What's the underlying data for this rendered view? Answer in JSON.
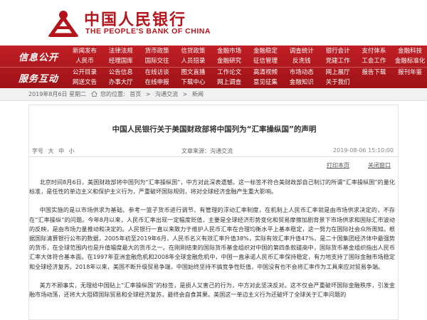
{
  "header": {
    "logo_cn": "中国人民银行",
    "logo_en": "THE PEOPLE'S BANK OF CHINA"
  },
  "nav": {
    "section1": "信息公开",
    "section2": "服务互动",
    "row1_top": [
      "新闻发布",
      "法律法规",
      "货币政策",
      "信贷政策",
      "金融市场",
      "金融稳定",
      "调查统计",
      "银行会计",
      "支付体系",
      "金融科技"
    ],
    "row1_bot": [
      "人民币",
      "经理国库",
      "国际交往",
      "人员招录",
      "金融研究",
      "征信管理",
      "反洗钱",
      "党建工作",
      "工会工作",
      "金融标准化"
    ],
    "row2_top": [
      "公开目录",
      "公告信息",
      "在线访谈",
      "图文直播",
      "工作论文",
      "高清视频",
      "市场动态",
      "网上展厅",
      "报告下载",
      "报刊年鉴"
    ],
    "row2_bot": [
      "网送文告",
      "办事大厅",
      "在线申报",
      "下载中心",
      "网上调查",
      "意见征集",
      "金融知识",
      "关于我们",
      "",
      ""
    ]
  },
  "breadcrumb": {
    "date": "2019年8月6日 星期二",
    "items": [
      "您的位置:",
      "首页",
      ">",
      "沟通交流",
      ">",
      "新闻"
    ]
  },
  "article": {
    "title": "中国人民银行关于美国财政部将中国列为“汇率操纵国”的声明",
    "font_size_label": "字号",
    "font_sizes": [
      "大",
      "中",
      "小"
    ],
    "source": "文章来源：沟通交流",
    "time": "2019-08-06 15:10:00",
    "print_label": "打印本页",
    "close_label": "关闭窗口",
    "paragraphs": [
      "北京时间8月6日，美国财政部将中国列为“汇率操纵国”，中方对此深表遗憾。这一标签不符合美财政部自己制订的所谓“汇率操纵国”的量化标准，是任性的单边主义和保护主义行为，严重破坏国际规则，将对全球经济金融产生重大影响。",
      "中国实施的是以市场供求为基础、参考一篮子货币进行调节、有管理的浮动汇率制度，在机制上人民币汇率就是由市场供求决定的，不存在“汇率操纵”的问题。今年8月以来，人民币汇率出现一定幅度贬值，主要是全球经济形势变化和贸易摩擦加剧背景下市场供求和国际汇市波动的反映，是由市场力量推动和决定的。人民银行一直以来致力于维护人民币汇率在合理均衡水平上基本稳定，这一努力在国际社会众所周知。根据国际清算银行公布的数据，2005年初至2019年6月，人民币名义有效汇率升值38%，实际有效汇率升值47%，是二十国集团经济体中最强势的货币，在全球范围内也是升值幅度最大的货币之一。在刚刚结束的国际货币基金组织对中国的第四条款磋商中，国际货币基金组织指出人民币汇率大体符合基本面。在1997年亚洲金融危机和2008年全球金融危机中，中国一直承诺人民币汇率保持稳定，有力地支持了国际金融市场稳定和全球经济复苏。2018年以来，美国不断升级贸易争端，中国始终坚持不搞竞争性贬值，中国没有也不会将汇率作为工具来应对贸易争端。",
      "美方不顾事实，无理给中国贴上“汇率操纵国”的标签，是损人又害己的行为，中方对此坚决反对。这不仅会严重破坏国际金融秩序，引发金融市场动荡，还将大大阻碍国际贸易和全球经济复苏，最终会自食其果。美国这一单边主义行为还破坏了全球关于汇率问题的"
    ]
  },
  "colors": {
    "brand_red": "#b4141b",
    "nav_red": "#b01a20"
  }
}
